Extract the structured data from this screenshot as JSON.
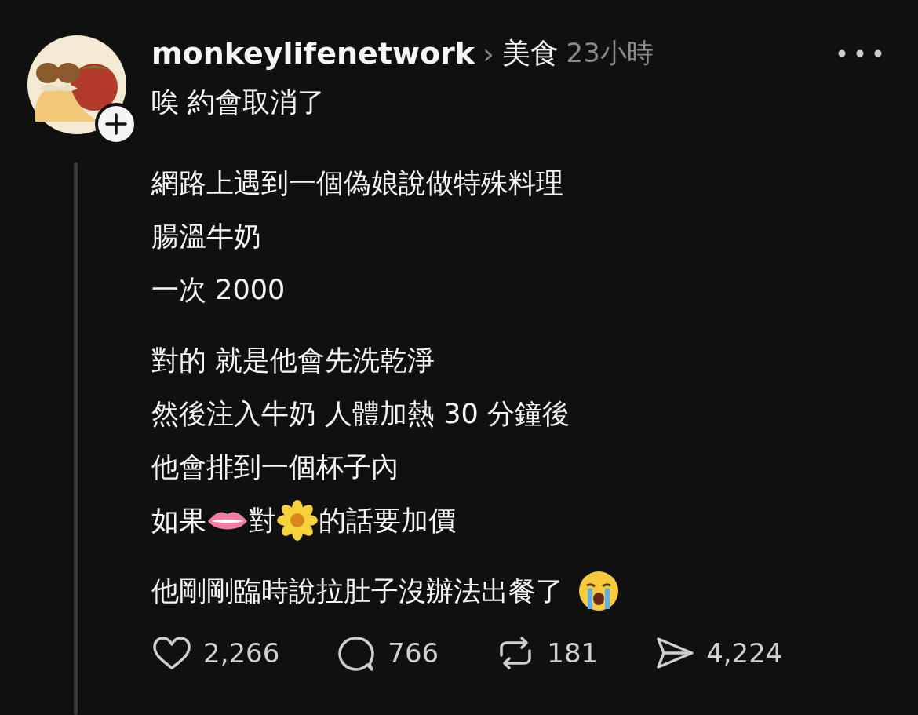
{
  "post": {
    "author": "monkeylifenetwork",
    "separator": "›",
    "topic": "美食",
    "time": "23小時"
  },
  "paragraphs": [
    {
      "lines": [
        [
          {
            "kind": "text",
            "text": "唉 約會取消了"
          }
        ]
      ]
    },
    {
      "lines": [
        [
          {
            "kind": "text",
            "text": "網路上遇到一個偽娘說做特殊料理"
          }
        ],
        [
          {
            "kind": "text",
            "text": "腸溫牛奶"
          }
        ],
        [
          {
            "kind": "text",
            "text": "一次 2000"
          }
        ]
      ]
    },
    {
      "lines": [
        [
          {
            "kind": "text",
            "text": "對的 就是他會先洗乾淨"
          }
        ],
        [
          {
            "kind": "text",
            "text": "然後注入牛奶 人體加熱 30 分鐘後"
          }
        ],
        [
          {
            "kind": "text",
            "text": "他會排到一個杯子內"
          }
        ],
        [
          {
            "kind": "text",
            "text": "如果"
          },
          {
            "kind": "lips"
          },
          {
            "kind": "text",
            "text": "對"
          },
          {
            "kind": "flower"
          },
          {
            "kind": "text",
            "text": "的話要加價"
          }
        ]
      ]
    },
    {
      "lines": [
        [
          {
            "kind": "text",
            "text": "他剛剛臨時說拉肚子沒辦法出餐了"
          },
          {
            "kind": "crying"
          }
        ]
      ]
    }
  ],
  "actions": [
    {
      "kind": "like",
      "count": "2,266"
    },
    {
      "kind": "comment",
      "count": "766"
    },
    {
      "kind": "repost",
      "count": "181"
    },
    {
      "kind": "share",
      "count": "4,224"
    }
  ]
}
